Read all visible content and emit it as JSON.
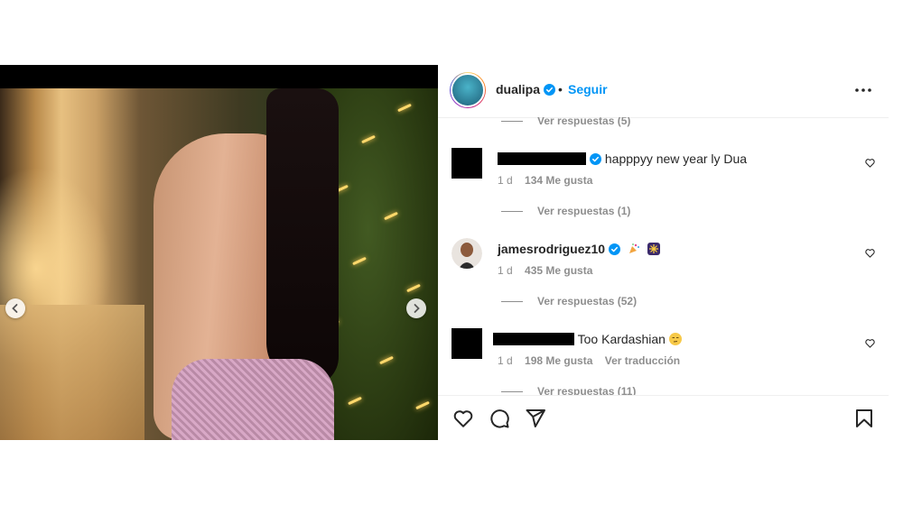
{
  "post": {
    "author": {
      "username": "dualipa",
      "verified": true
    },
    "separator": "•",
    "follow_label": "Seguir"
  },
  "media": {
    "prev_icon": "chevron-left-icon",
    "next_icon": "chevron-right-icon"
  },
  "comments": [
    {
      "replies_label": "Ver respuestas (5)"
    },
    {
      "username_redacted": true,
      "verified": true,
      "text": "happpyy new year ly Dua",
      "time": "1 d",
      "likes": "134 Me gusta",
      "replies_label": "Ver respuestas (1)"
    },
    {
      "username": "jamesrodriguez10",
      "verified": true,
      "emojis": [
        "party-popper-emoji",
        "fireworks-emoji"
      ],
      "time": "1 d",
      "likes": "435 Me gusta",
      "replies_label": "Ver respuestas (52)"
    },
    {
      "username_redacted": true,
      "text": "Too Kardashian",
      "emoji": "unamused-face-emoji",
      "time": "1 d",
      "likes": "198 Me gusta",
      "translate_label": "Ver traducción",
      "replies_label": "Ver respuestas (11)"
    }
  ],
  "actions": [
    "heart-icon",
    "comment-icon",
    "share-icon",
    "save-icon"
  ],
  "colors": {
    "link": "#0095f6",
    "muted": "#8e8e8e",
    "text": "#262626"
  }
}
